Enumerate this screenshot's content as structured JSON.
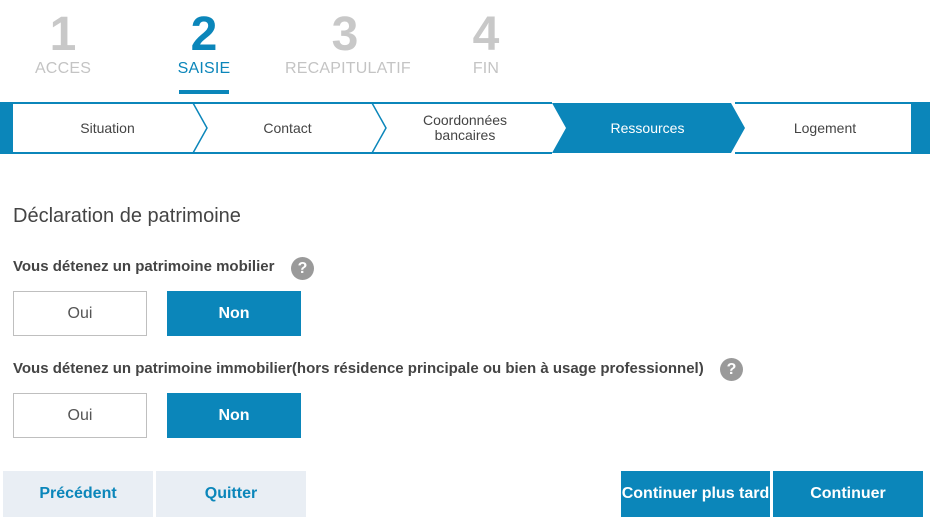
{
  "steps": [
    {
      "number": "1",
      "label": "ACCES"
    },
    {
      "number": "2",
      "label": "SAISIE"
    },
    {
      "number": "3",
      "label": "RECAPITULATIF"
    },
    {
      "number": "4",
      "label": "FIN"
    }
  ],
  "progress": {
    "segments": [
      "Situation",
      "Contact",
      "Coordonnées bancaires",
      "Ressources",
      "Logement"
    ],
    "active_index": 3
  },
  "form": {
    "title": "Déclaration de patrimoine",
    "question1": {
      "label": "Vous détenez un patrimoine mobilier",
      "yes_label": "Oui",
      "no_label": "Non",
      "selected": "Non"
    },
    "question2": {
      "label": "Vous détenez un patrimoine immobilier(hors résidence principale ou bien à usage professionnel)",
      "yes_label": "Oui",
      "no_label": "Non",
      "selected": "Non"
    },
    "help_symbol": "?"
  },
  "actions": {
    "previous": "Précédent",
    "quit": "Quitter",
    "continue_later": "Continuer plus tard",
    "continue": "Continuer"
  },
  "colors": {
    "accent": "#0b86ba",
    "inactive_step": "#c8c8c8",
    "secondary_button_bg": "#e9eef4"
  }
}
